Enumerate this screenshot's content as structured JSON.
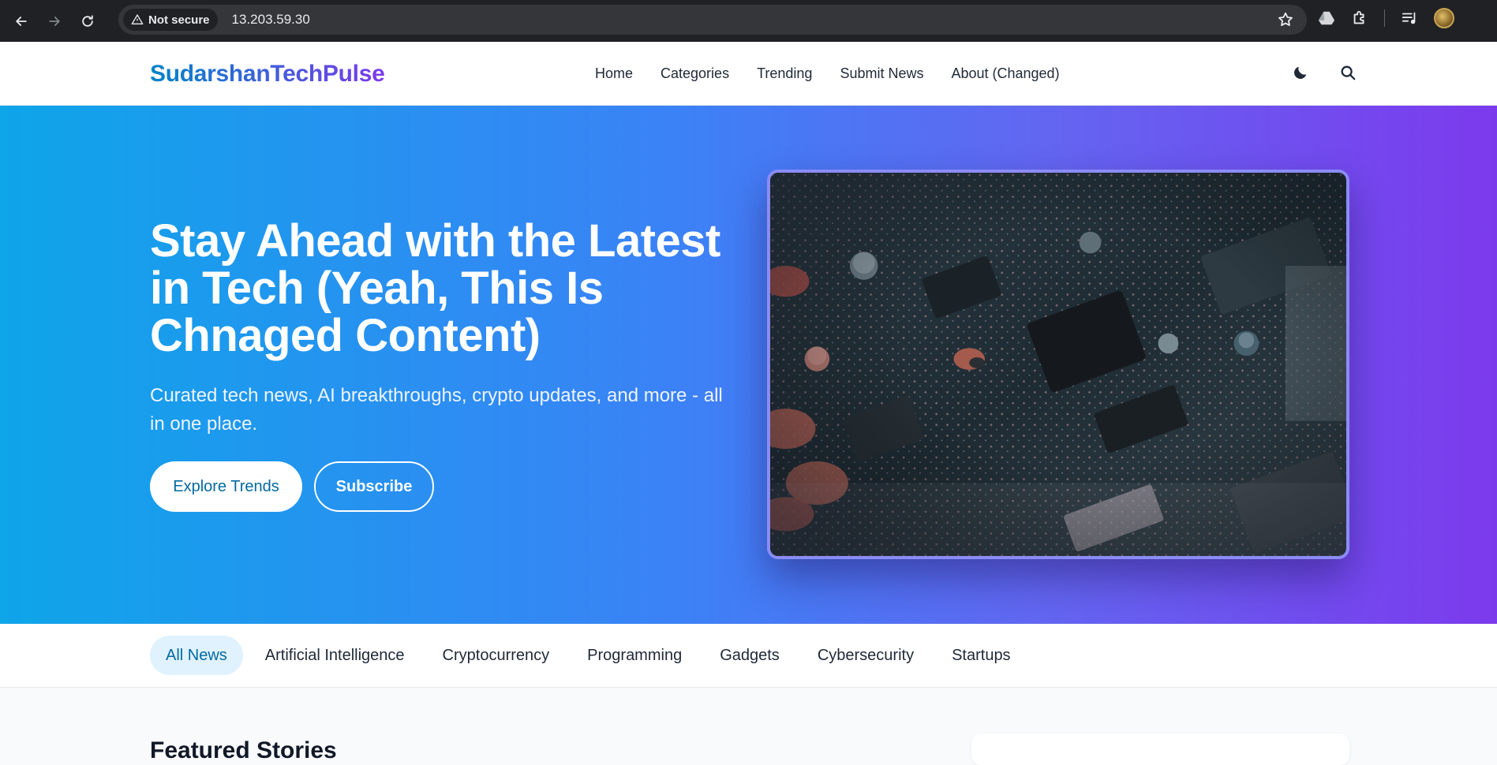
{
  "browser": {
    "security_label": "Not secure",
    "url": "13.203.59.30"
  },
  "site": {
    "logo": "SudarshanTechPulse",
    "nav": [
      "Home",
      "Categories",
      "Trending",
      "Submit News",
      "About (Changed)"
    ]
  },
  "hero": {
    "title": "Stay Ahead with the Latest in Tech (Yeah, This Is Chnaged Content)",
    "subtitle": "Curated tech news, AI breakthroughs, crypto updates, and more - all in one place.",
    "primary_button": "Explore Trends",
    "secondary_button": "Subscribe"
  },
  "categories": {
    "items": [
      "All News",
      "Artificial Intelligence",
      "Cryptocurrency",
      "Programming",
      "Gadgets",
      "Cybersecurity",
      "Startups"
    ],
    "active": "All News"
  },
  "featured": {
    "title": "Featured Stories"
  },
  "colors": {
    "brand_start": "#0284c7",
    "brand_end": "#7c3aed",
    "hero_start": "#0ea5e9",
    "hero_end": "#7c3aed",
    "active_chip_bg": "#e0f2fe"
  },
  "icons": {
    "theme_toggle": "moon-icon",
    "search": "search-icon"
  }
}
